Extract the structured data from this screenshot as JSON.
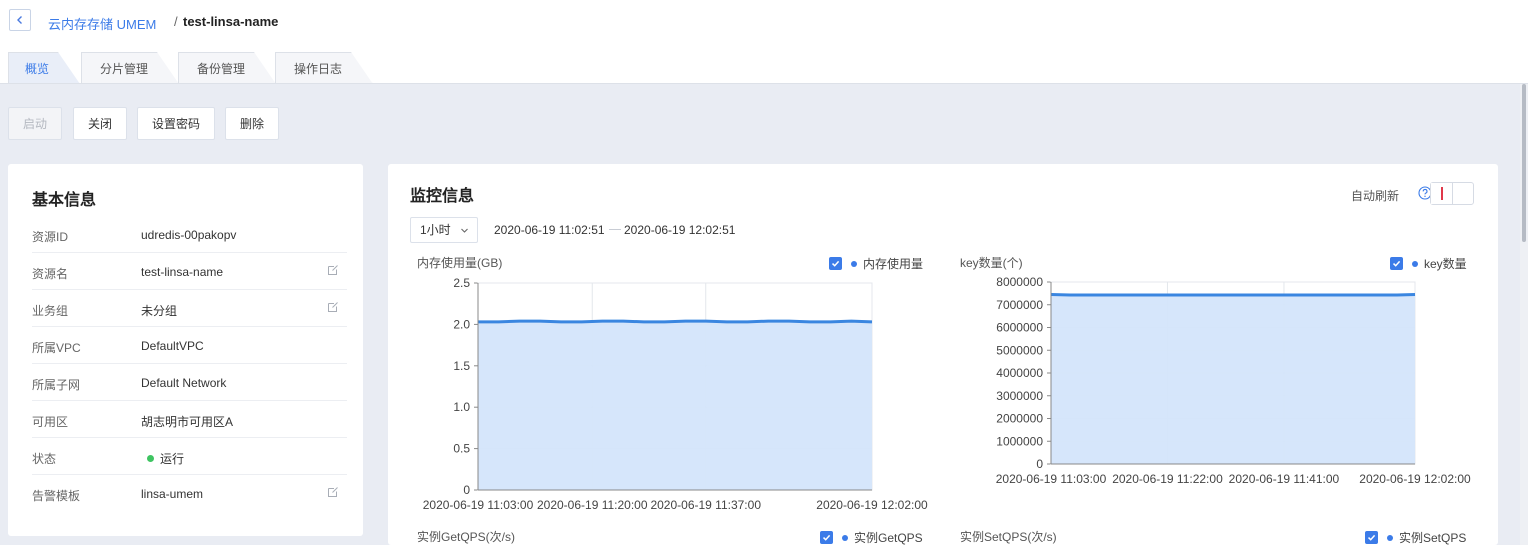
{
  "breadcrumb": {
    "parent": "云内存存储 UMEM",
    "separator": "/",
    "current": "test-linsa-name"
  },
  "tabs": [
    "概览",
    "分片管理",
    "备份管理",
    "操作日志"
  ],
  "actions": {
    "start": "启动",
    "stop": "关闭",
    "set_password": "设置密码",
    "delete": "删除"
  },
  "basic_info": {
    "title": "基本信息",
    "rows": [
      {
        "label": "资源ID",
        "value": "udredis-00pakopv"
      },
      {
        "label": "资源名",
        "value": "test-linsa-name"
      },
      {
        "label": "业务组",
        "value": "未分组"
      },
      {
        "label": "所属VPC",
        "value": "DefaultVPC"
      },
      {
        "label": "所属子网",
        "value": "Default Network"
      },
      {
        "label": "可用区",
        "value": "胡志明市可用区A"
      },
      {
        "label": "状态",
        "value": "运行"
      },
      {
        "label": "告警模板",
        "value": "linsa-umem"
      }
    ],
    "status_color": "#3ec461"
  },
  "monitor": {
    "title": "监控信息",
    "auto_refresh_label": "自动刷新",
    "range": "1小时",
    "time_start": "2020-06-19 11:02:51",
    "time_end": "2020-06-19 12:02:51",
    "lower_titles": [
      "实例GetQPS(次/s)",
      "实例SetQPS(次/s)"
    ],
    "lower_legends": [
      "实例GetQPS",
      "实例SetQPS"
    ]
  },
  "colors": {
    "accent": "#3b7be8",
    "series_line": "#3a86e0",
    "series_fill": "#d4e5fb"
  },
  "chart_data": [
    {
      "type": "area",
      "title": "内存使用量(GB)",
      "series": [
        {
          "name": "内存使用量",
          "values": [
            2.03,
            2.03,
            2.04,
            2.04,
            2.03,
            2.03,
            2.04,
            2.04,
            2.03,
            2.03,
            2.04,
            2.04,
            2.03,
            2.03,
            2.04,
            2.04,
            2.03,
            2.03,
            2.04,
            2.03
          ]
        }
      ],
      "x_ticks": [
        "2020-06-19 11:03:00",
        "2020-06-19 11:20:00",
        "2020-06-19 11:37:00",
        "2020-06-19 12:02:00"
      ],
      "y_ticks": [
        "2.5",
        "2.0",
        "1.5",
        "1.0",
        "0.5",
        "0"
      ],
      "ylim": [
        0,
        2.5
      ]
    },
    {
      "type": "area",
      "title": "key数量(个)",
      "series": [
        {
          "name": "key数量",
          "values": [
            7450000,
            7430000,
            7430000,
            7430000,
            7430000,
            7430000,
            7430000,
            7430000,
            7430000,
            7430000,
            7430000,
            7430000,
            7430000,
            7430000,
            7430000,
            7430000,
            7430000,
            7430000,
            7430000,
            7450000
          ]
        }
      ],
      "x_ticks": [
        "2020-06-19 11:03:00",
        "2020-06-19 11:22:00",
        "2020-06-19 11:41:00",
        "2020-06-19 12:02:00"
      ],
      "y_ticks": [
        "8000000",
        "7000000",
        "6000000",
        "5000000",
        "4000000",
        "3000000",
        "2000000",
        "1000000",
        "0"
      ],
      "ylim": [
        0,
        8000000
      ]
    }
  ]
}
